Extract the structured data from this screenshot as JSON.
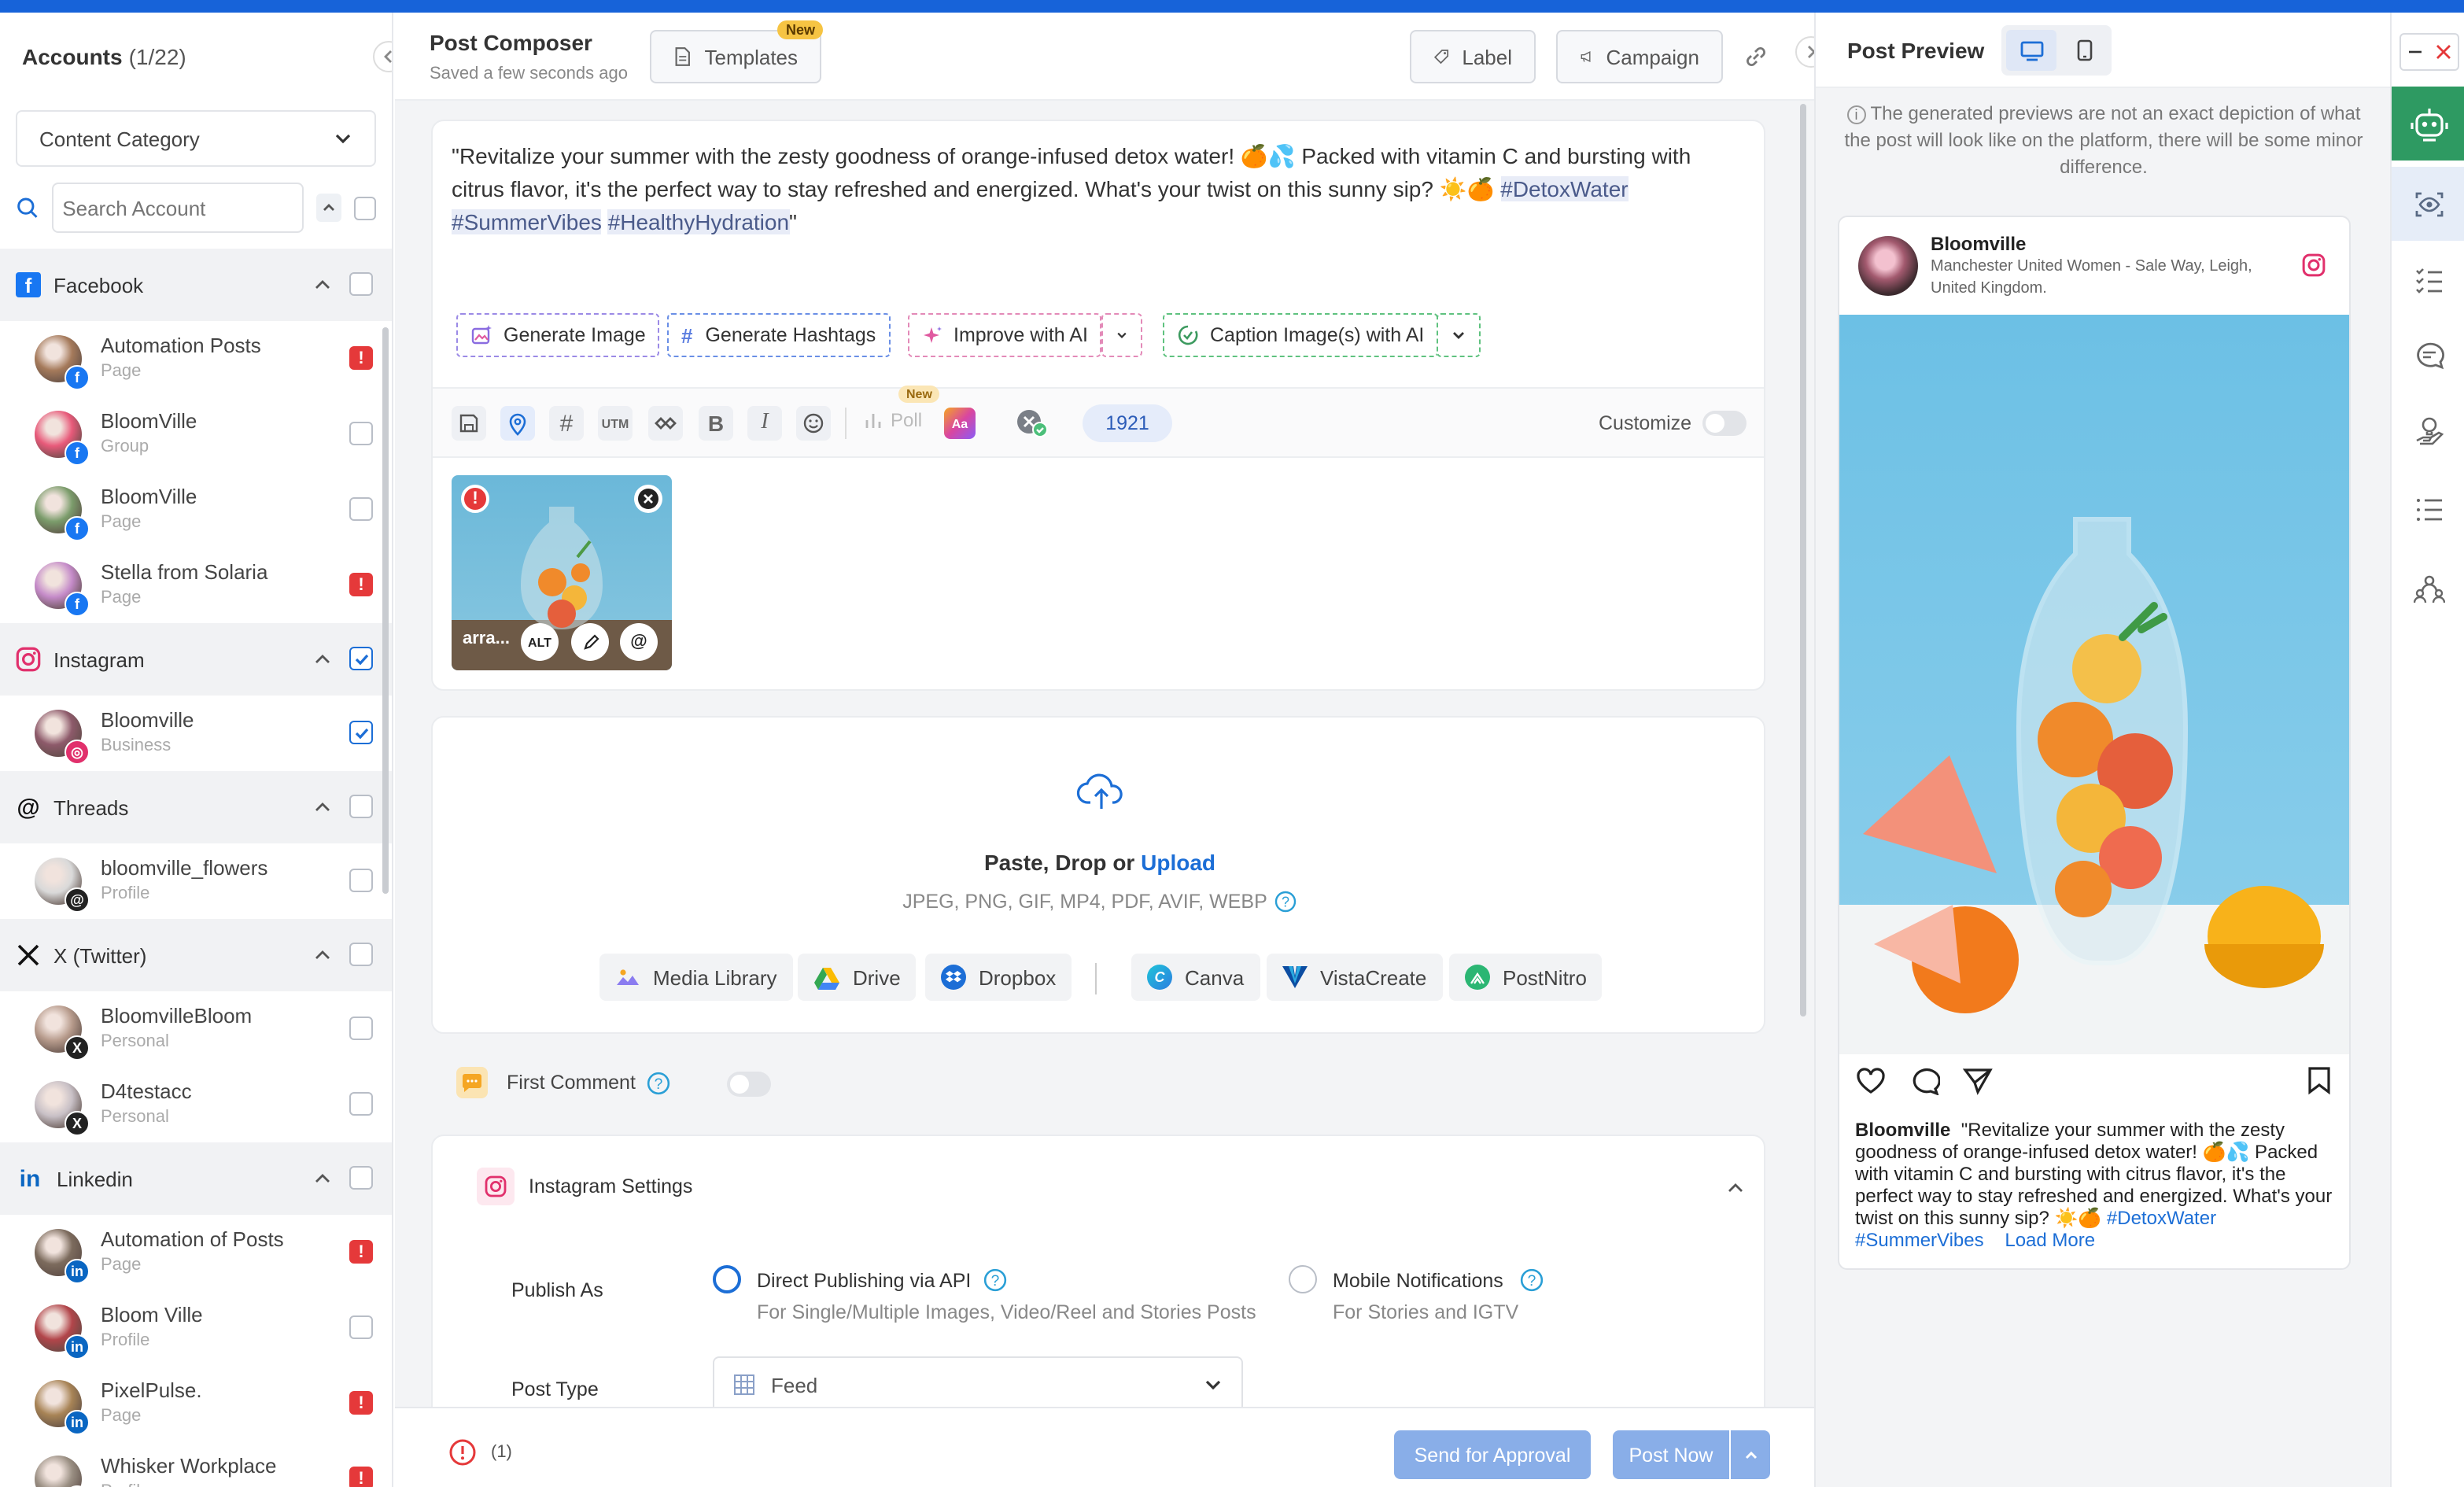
{
  "accounts": {
    "title": "Accounts",
    "count": "(1/22)",
    "category_label": "Content Category",
    "search_placeholder": "Search Account",
    "groups": [
      {
        "name": "Facebook",
        "color": "#1877f2",
        "checked": false,
        "items": [
          {
            "name": "Automation Posts",
            "type": "Page",
            "warn": true,
            "avatar": "#a57a5b"
          },
          {
            "name": "BloomVille",
            "type": "Group",
            "warn": false,
            "avatar": "#e85a7a"
          },
          {
            "name": "BloomVille",
            "type": "Page",
            "warn": false,
            "avatar": "#7b9c6b"
          },
          {
            "name": "Stella from Solaria",
            "type": "Page",
            "warn": true,
            "avatar": "#c58bc9"
          }
        ]
      },
      {
        "name": "Instagram",
        "color": "#e1306c",
        "checked": true,
        "items": [
          {
            "name": "Bloomville",
            "type": "Business",
            "warn": false,
            "checked": true,
            "avatar": "#8d5a6a"
          }
        ]
      },
      {
        "name": "Threads",
        "color": "#222222",
        "checked": false,
        "items": [
          {
            "name": "bloomville_flowers",
            "type": "Profile",
            "warn": false,
            "avatar": "#d9d9d9"
          }
        ]
      },
      {
        "name": "X (Twitter)",
        "color": "#111111",
        "checked": false,
        "items": [
          {
            "name": "BloomvilleBloom",
            "type": "Personal",
            "warn": false,
            "avatar": "#b79b8c"
          },
          {
            "name": "D4testacc",
            "type": "Personal",
            "warn": false,
            "avatar": "#c8c0c6"
          }
        ]
      },
      {
        "name": "Linkedin",
        "color": "#0a66c2",
        "checked": false,
        "items": [
          {
            "name": "Automation of Posts",
            "type": "Page",
            "warn": true,
            "avatar": "#7c6b5d"
          },
          {
            "name": "Bloom Ville",
            "type": "Profile",
            "warn": false,
            "avatar": "#b2454a"
          },
          {
            "name": "PixelPulse.",
            "type": "Page",
            "warn": true,
            "avatar": "#a88456"
          },
          {
            "name": "Whisker Workplace",
            "type": "Profile",
            "warn": true,
            "avatar": "#9a8f83"
          }
        ]
      }
    ]
  },
  "composer": {
    "title": "Post Composer",
    "saved": "Saved a few seconds ago",
    "templates": "Templates",
    "new_badge": "New",
    "label_btn": "Label",
    "campaign_btn": "Campaign",
    "text_part1": "\"Revitalize your summer with the zesty goodness of orange-infused detox water! 🍊💦 Packed with vitamin C and bursting with citrus flavor, it's the perfect way to stay refreshed and energized. What's your twist on this sunny sip? ☀️🍊 ",
    "tag1": "#DetoxWater",
    "tag2": "#SummerVibes",
    "tag3": "#HealthyHydration",
    "text_end": "\"",
    "ai": {
      "gen_image": "Generate Image",
      "gen_hashtags": "Generate Hashtags",
      "improve": "Improve with AI",
      "caption": "Caption Image(s) with AI"
    },
    "toolbar": {
      "utm": "UTM",
      "poll": "Poll",
      "poll_badge": "New",
      "char_count": "1921",
      "customize": "Customize"
    },
    "media_label": "arra...",
    "alt": "ALT",
    "upload": {
      "text": "Paste, Drop or ",
      "link": "Upload",
      "formats": "JPEG, PNG, GIF, MP4, PDF, AVIF, WEBP",
      "sources": [
        "Media Library",
        "Drive",
        "Dropbox",
        "Canva",
        "VistaCreate",
        "PostNitro"
      ]
    },
    "first_comment": "First Comment",
    "ig_settings": {
      "title": "Instagram Settings",
      "publish_as": "Publish As",
      "opt1": "Direct Publishing via API",
      "opt1_sub": "For Single/Multiple Images, Video/Reel and Stories Posts",
      "opt2": "Mobile Notifications",
      "opt2_sub": "For Stories and IGTV",
      "post_type": "Post Type",
      "post_type_value": "Feed"
    },
    "footer": {
      "error_count": "(1)",
      "send_approval": "Send for Approval",
      "post_now": "Post Now"
    }
  },
  "preview": {
    "title": "Post Preview",
    "notice": "The generated previews are not an exact depiction of what the post will look like on the platform, there will be some minor difference.",
    "account": "Bloomville",
    "location": "Manchester United Women - Sale Way, Leigh, United Kingdom.",
    "caption_name": "Bloomville",
    "caption": "\"Revitalize your summer with the zesty goodness of orange-infused detox water! 🍊💦 Packed with vitamin C and bursting with citrus flavor, it's the perfect way to stay refreshed and energized. What's your twist on this sunny sip? ☀️🍊 ",
    "caption_tag1": "#DetoxWater",
    "caption_tag2": "#SummerVibes",
    "load_more": "Load More"
  },
  "colors": {
    "accent": "#1c6ed6",
    "topbar": "#1763d9",
    "warn": "#e5393a",
    "ai_green": "#3c9a5f"
  }
}
